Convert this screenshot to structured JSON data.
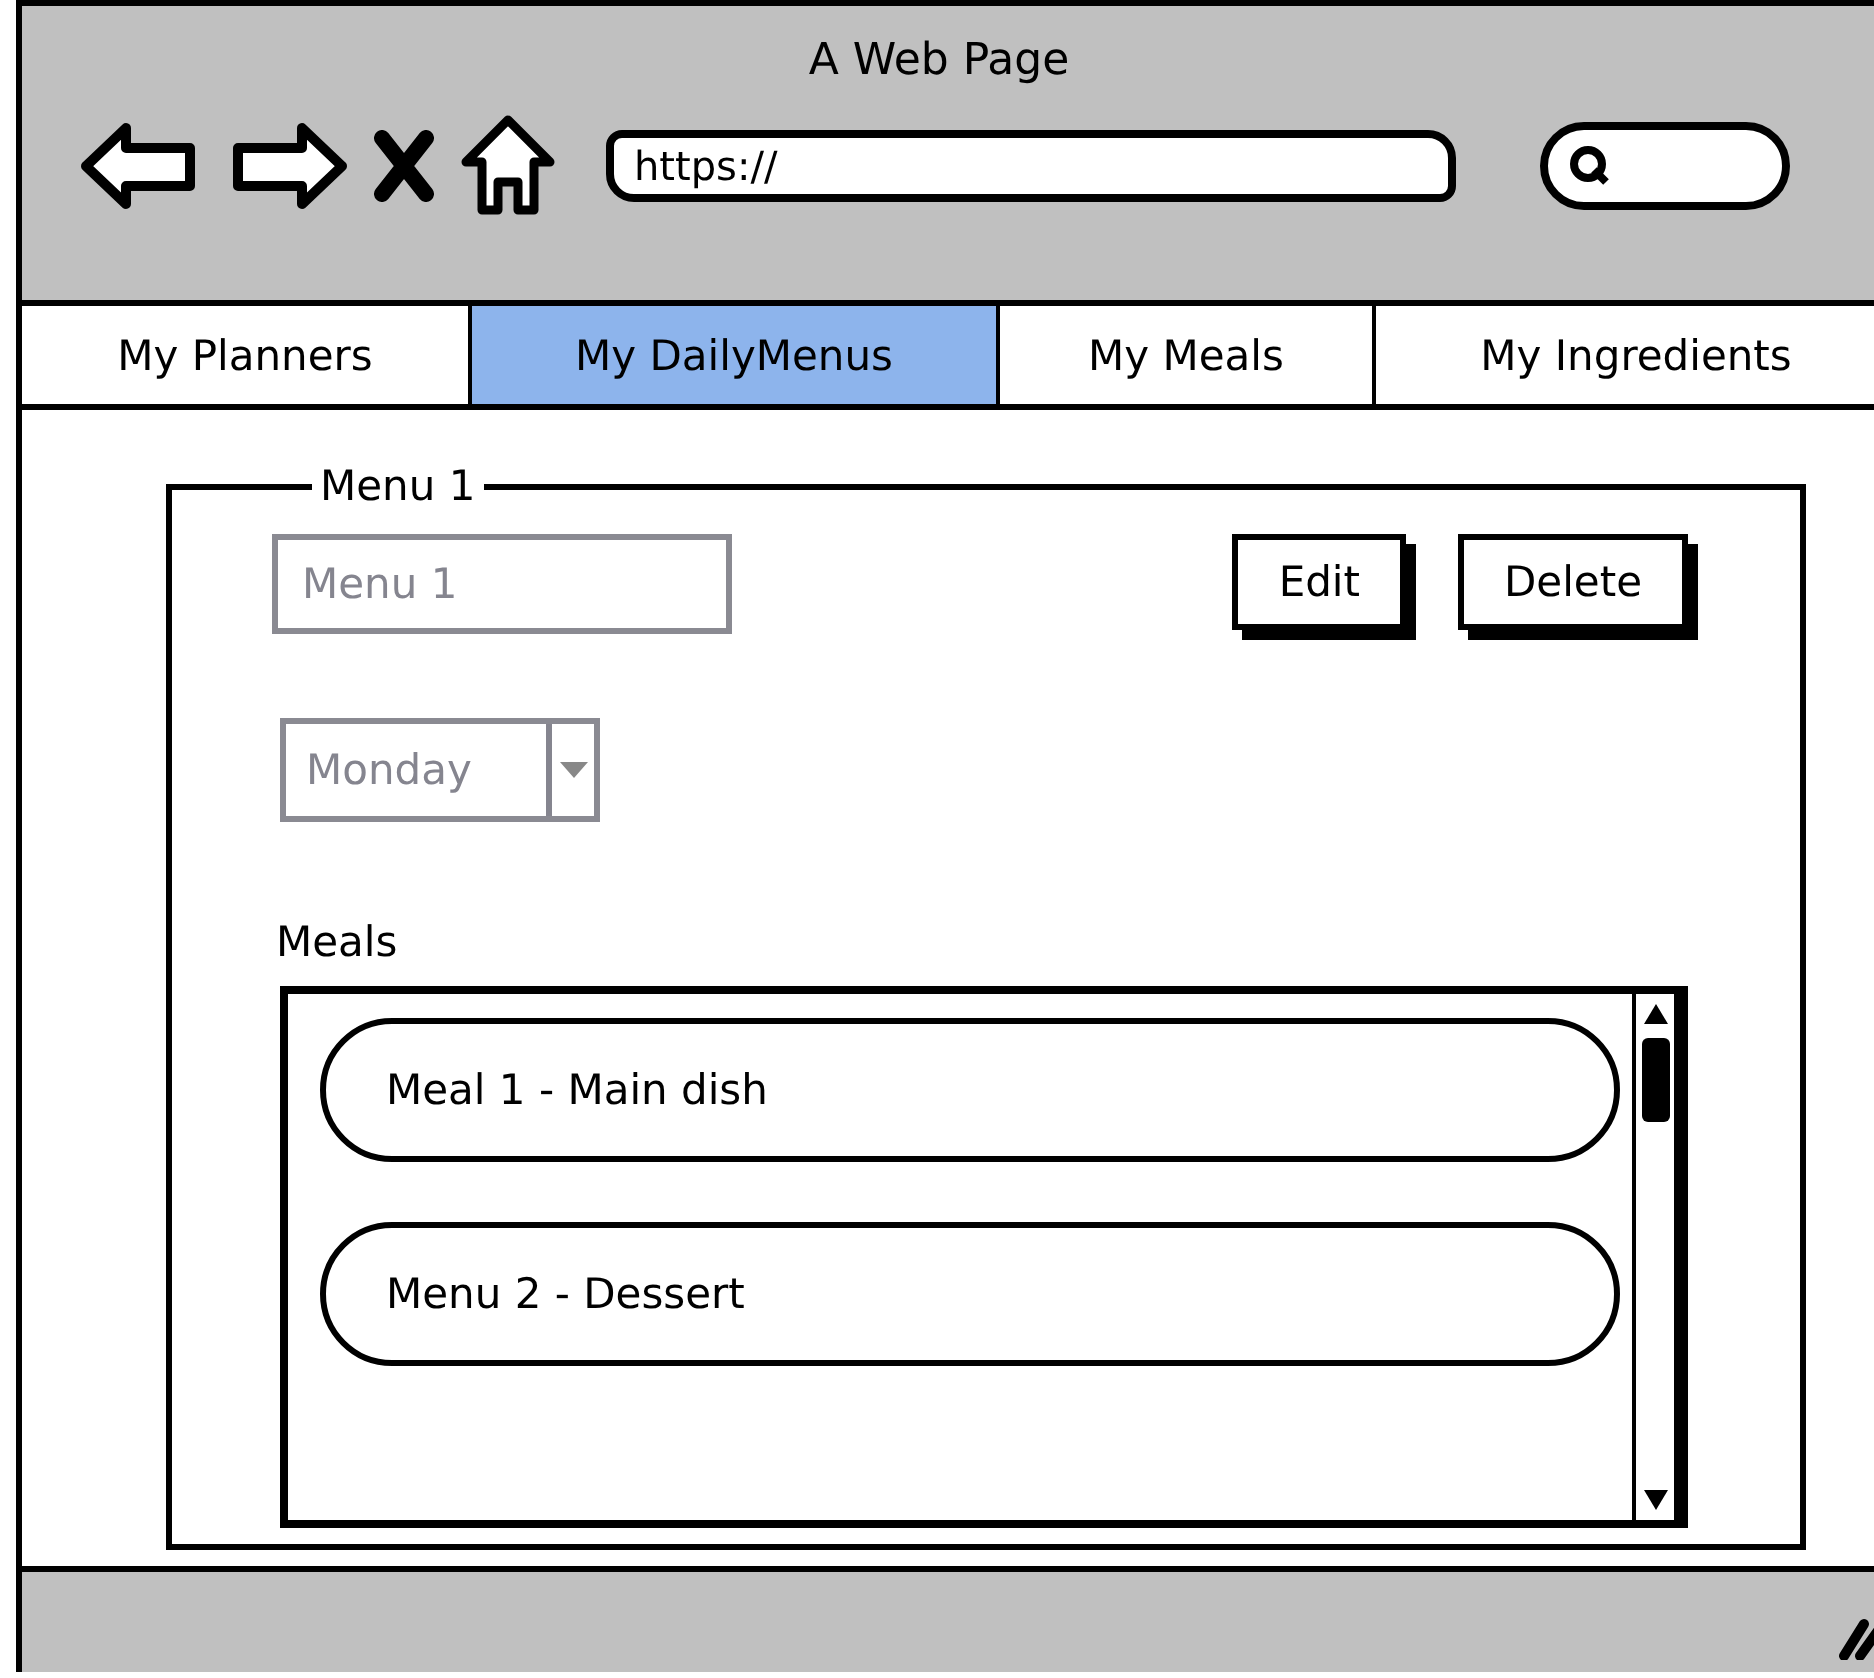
{
  "window": {
    "title": "A Web Page"
  },
  "browser": {
    "url": "https://"
  },
  "tabs": [
    {
      "label": "My Planners",
      "selected": false
    },
    {
      "label": "My DailyMenus",
      "selected": true
    },
    {
      "label": "My Meals",
      "selected": false
    },
    {
      "label": "My Ingredients",
      "selected": false
    }
  ],
  "menu_group": {
    "title": "Menu 1",
    "name_field": {
      "value": "Menu 1",
      "disabled": true
    },
    "day_select": {
      "value": "Monday",
      "disabled": true
    },
    "buttons": [
      "Edit",
      "Delete"
    ],
    "meals_label": "Meals",
    "meals": [
      "Meal 1 - Main dish",
      "Menu 2 - Dessert"
    ]
  }
}
